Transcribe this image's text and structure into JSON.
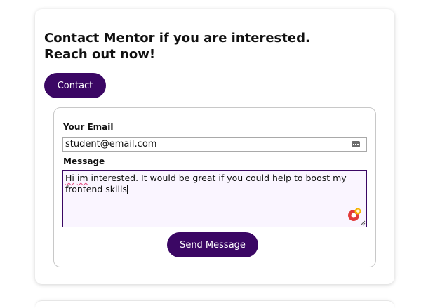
{
  "card": {
    "headline_line1": "Contact Mentor if you are interested.",
    "headline_line2": "Reach out now!",
    "contact_label": "Contact"
  },
  "form": {
    "email_label": "Your Email",
    "email_value": "student@email.com",
    "message_label": "Message",
    "message_word1": "Hi",
    "message_word2": "im",
    "message_rest": " interested. It would be great if you could help to boost my frontend skills",
    "send_label": "Send Message"
  },
  "icons": {
    "autofill": "autofill-key-icon",
    "grammar": "grammar-assistant-icon",
    "resize": "resize-handle-icon"
  },
  "colors": {
    "accent": "#3b0764",
    "textarea_bg": "#faf5ff",
    "spell_underline": "#e0457b"
  }
}
